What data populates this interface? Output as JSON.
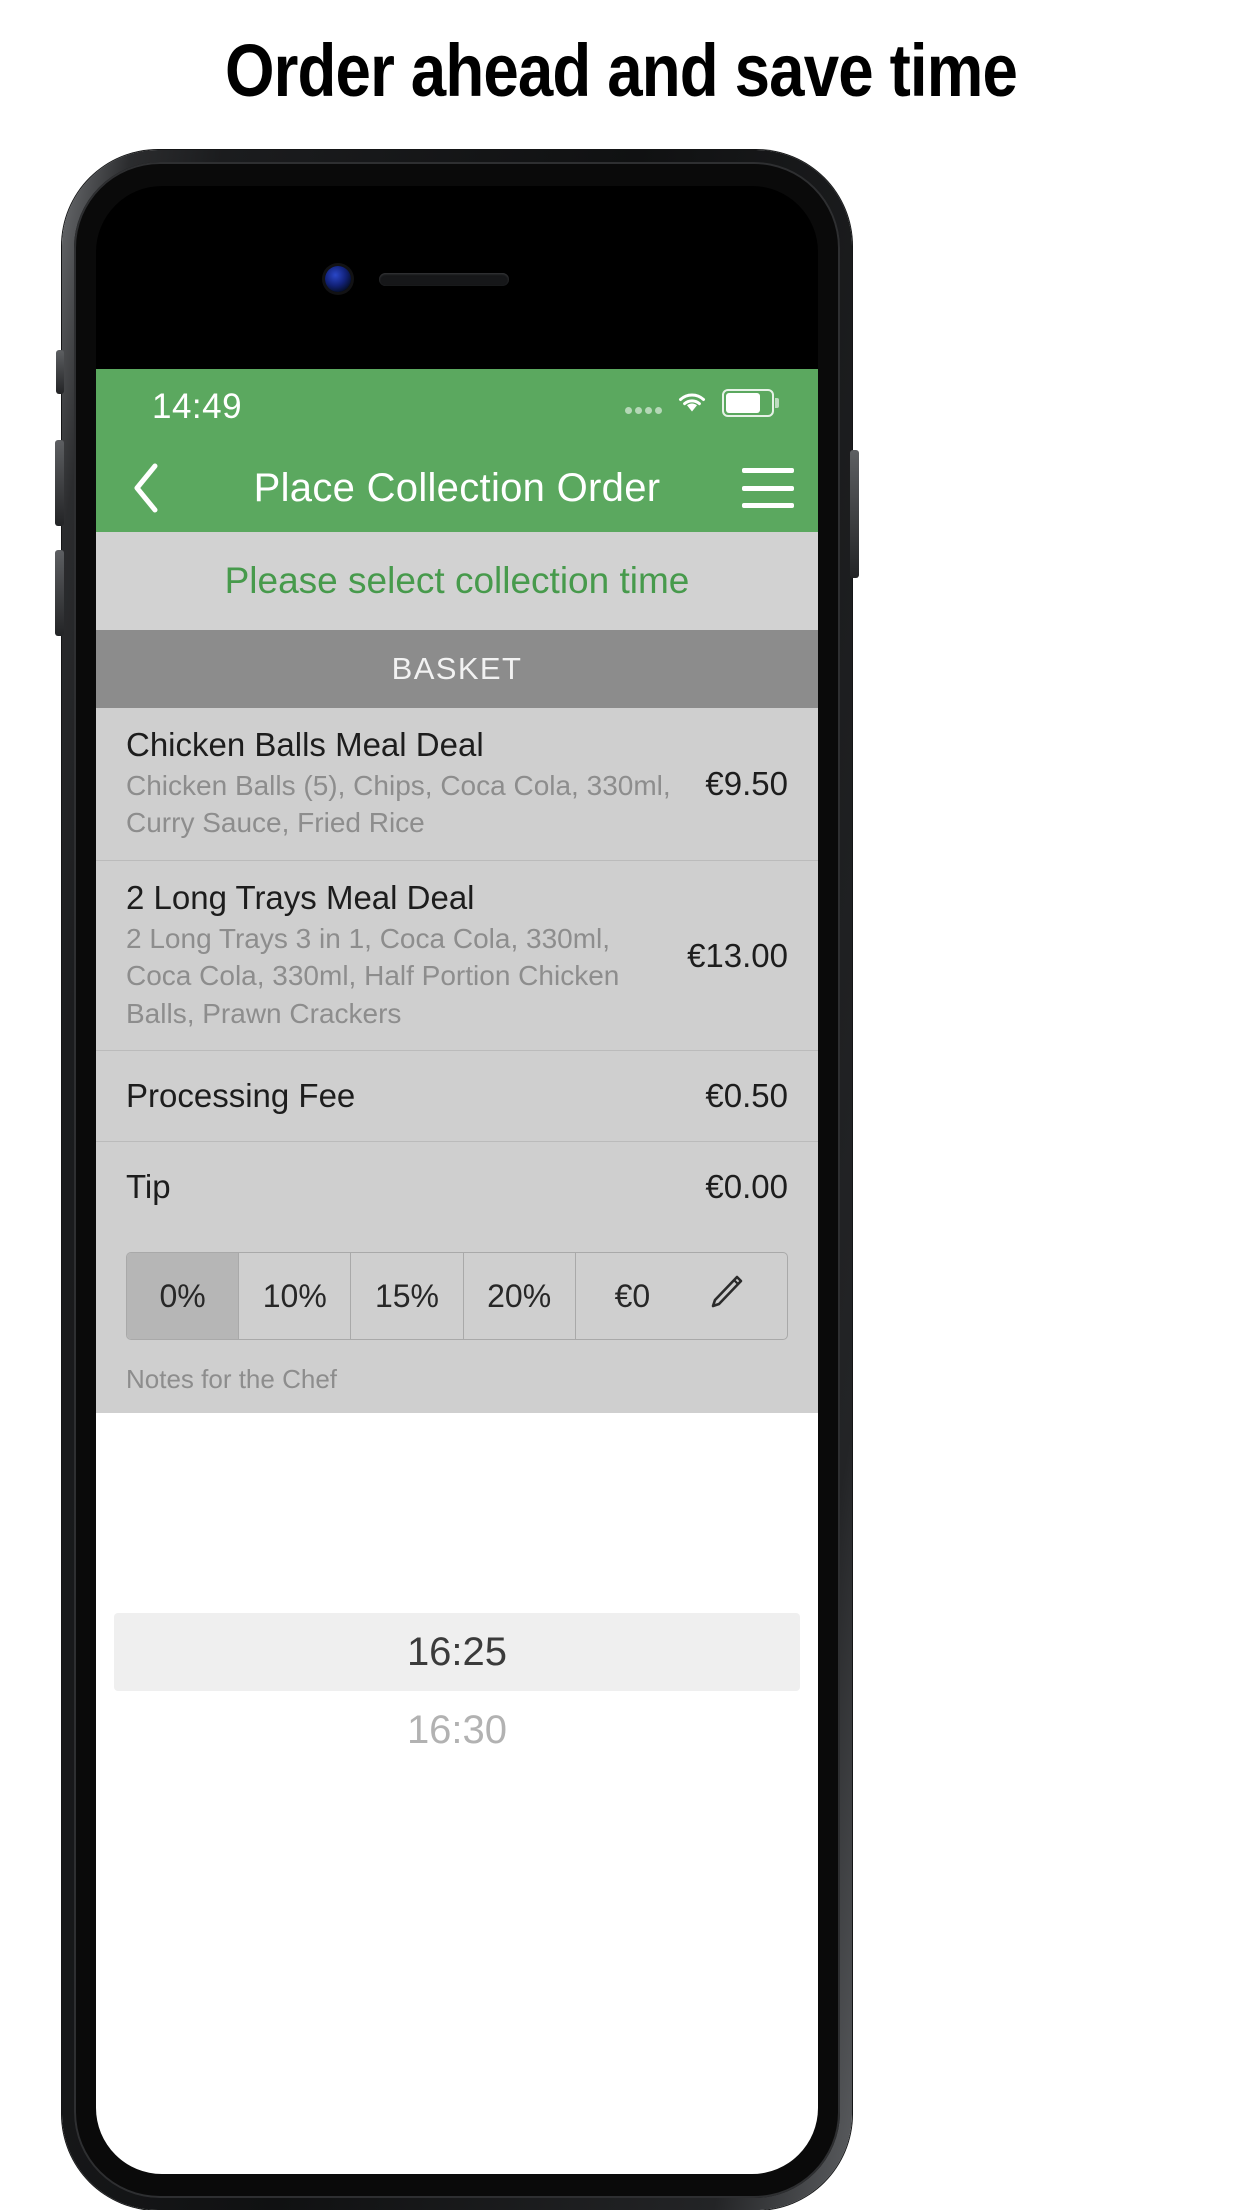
{
  "headline": "Order ahead and save time",
  "colors": {
    "brand_green": "#5BA85F",
    "banner_text_green": "#479a4c",
    "basket_header_gray": "#8C8C8C",
    "basket_bg": "#CFCFCF",
    "banner_bg": "#D2D2D2"
  },
  "phone": {
    "camera_icon": "front-camera",
    "speaker_icon": "earpiece-speaker"
  },
  "app": {
    "statusbar": {
      "time": "14:49",
      "signal_icon": "signal-dots",
      "wifi_icon": "wifi-icon",
      "battery_icon": "battery-icon"
    },
    "navbar": {
      "back_icon": "chevron-left-icon",
      "title": "Place Collection Order",
      "menu_icon": "hamburger-menu-icon"
    },
    "banner": {
      "text": "Please select collection time"
    },
    "basket": {
      "header": "BASKET",
      "items": [
        {
          "title": "Chicken Balls Meal Deal",
          "desc": "Chicken Balls (5), Chips, Coca Cola, 330ml, Curry Sauce, Fried Rice",
          "price": "€9.50"
        },
        {
          "title": "2 Long Trays Meal Deal",
          "desc": "2 Long Trays 3 in 1, Coca Cola, 330ml, Coca Cola, 330ml, Half Portion Chicken Balls, Prawn Crackers",
          "price": "€13.00"
        }
      ],
      "fees": [
        {
          "label": "Processing Fee",
          "value": "€0.50"
        },
        {
          "label": "Tip",
          "value": "€0.00"
        }
      ]
    },
    "tip_options": [
      {
        "label": "0%",
        "selected": true
      },
      {
        "label": "10%",
        "selected": false
      },
      {
        "label": "15%",
        "selected": false
      },
      {
        "label": "20%",
        "selected": false
      },
      {
        "label": "€0",
        "selected": false
      }
    ],
    "tip_edit_icon": "pencil-icon",
    "notes": {
      "label": "Notes for the Chef",
      "value": ""
    },
    "time_picker": {
      "selected": "16:25",
      "next": "16:30"
    }
  }
}
